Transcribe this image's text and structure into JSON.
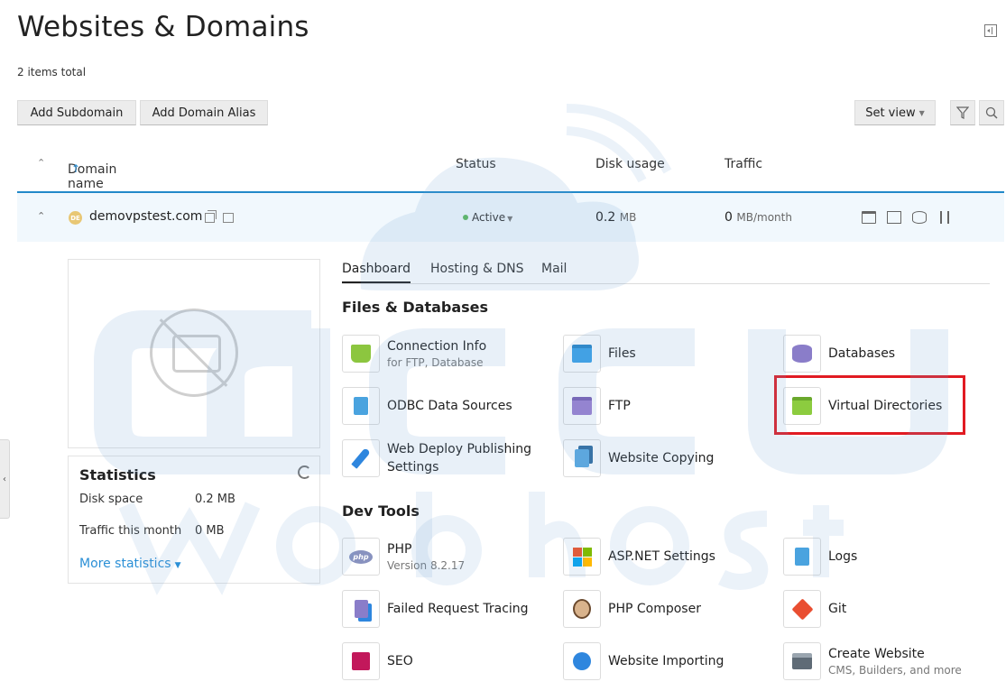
{
  "header": {
    "title": "Websites & Domains",
    "items_total": "2 items total"
  },
  "toolbar": {
    "add_subdomain": "Add Subdomain",
    "add_domain_alias": "Add Domain Alias",
    "set_view": "Set view"
  },
  "table": {
    "columns": {
      "domain": "Domain name",
      "status": "Status",
      "disk": "Disk usage",
      "traffic": "Traffic"
    },
    "row": {
      "badge": "DE",
      "domain": "demovpstest.com",
      "status": "Active",
      "disk_value": "0.2",
      "disk_unit": "MB",
      "traffic_value": "0",
      "traffic_unit": "MB/month"
    }
  },
  "statistics": {
    "title": "Statistics",
    "disk_label": "Disk space",
    "disk_value": "0.2 MB",
    "traffic_label": "Traffic this month",
    "traffic_value": "0 MB",
    "more": "More statistics"
  },
  "tabs": [
    "Dashboard",
    "Hosting & DNS",
    "Mail"
  ],
  "sections": {
    "files_db": "Files & Databases",
    "dev_tools": "Dev Tools"
  },
  "tools": {
    "connection_info": {
      "label": "Connection Info",
      "sub": "for FTP, Database"
    },
    "files": {
      "label": "Files"
    },
    "databases": {
      "label": "Databases"
    },
    "odbc": {
      "label": "ODBC Data Sources"
    },
    "ftp": {
      "label": "FTP"
    },
    "virtual_directories": {
      "label": "Virtual Directories"
    },
    "web_deploy": {
      "label": "Web Deploy Publishing Settings"
    },
    "website_copying": {
      "label": "Website Copying"
    },
    "php": {
      "label": "PHP",
      "sub": "Version 8.2.17"
    },
    "aspnet": {
      "label": "ASP.NET Settings"
    },
    "logs": {
      "label": "Logs"
    },
    "failed_tracing": {
      "label": "Failed Request Tracing"
    },
    "php_composer": {
      "label": "PHP Composer"
    },
    "git": {
      "label": "Git"
    },
    "seo": {
      "label": "SEO"
    },
    "website_importing": {
      "label": "Website Importing"
    },
    "create_website": {
      "label": "Create Website",
      "sub": "CMS, Builders, and more"
    }
  },
  "icons": {
    "php_glyph": "php"
  },
  "colors": {
    "accent_blue": "#2289c9",
    "highlight_red": "#e11b22",
    "status_green": "#5cb85c"
  }
}
